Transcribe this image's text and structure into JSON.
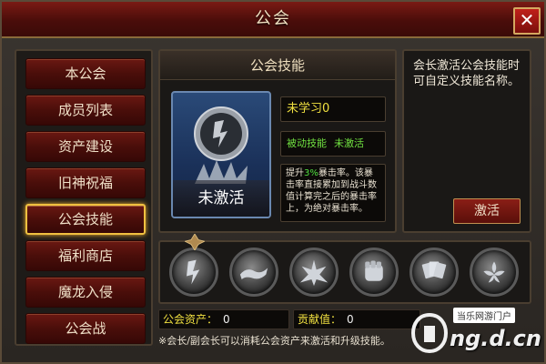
{
  "window": {
    "title": "公会",
    "close_icon": "close-icon",
    "close_glyph": "✕"
  },
  "sidebar": {
    "items": [
      {
        "label": "本公会",
        "active": false
      },
      {
        "label": "成员列表",
        "active": false
      },
      {
        "label": "资产建设",
        "active": false
      },
      {
        "label": "旧神祝福",
        "active": false
      },
      {
        "label": "公会技能",
        "active": true
      },
      {
        "label": "福利商店",
        "active": false
      },
      {
        "label": "魔龙入侵",
        "active": false
      },
      {
        "label": "公会战",
        "active": false
      }
    ]
  },
  "skill_panel": {
    "title": "公会技能",
    "card_status": "未激活",
    "level_text": "未学习0",
    "type_label": "被动技能",
    "type_status": "未激活",
    "desc_prefix": "提升",
    "desc_highlight": "3%",
    "desc_suffix": "暴击率。该暴击率直接累加到战斗数值计算完之后的暴击率上，为绝对暴击率。"
  },
  "right_panel": {
    "description": "会长激活公会技能时可自定义技能名称。",
    "activate_label": "激活"
  },
  "skill_slots": [
    {
      "icon": "claw-skill-icon",
      "selected": true
    },
    {
      "icon": "hands-skill-icon",
      "selected": false
    },
    {
      "icon": "wings-skill-icon",
      "selected": false
    },
    {
      "icon": "fist-skill-icon",
      "selected": false
    },
    {
      "icon": "cards-skill-icon",
      "selected": false
    },
    {
      "icon": "flower-skill-icon",
      "selected": false
    }
  ],
  "stats": {
    "assets_label": "公会资产：",
    "assets_value": "0",
    "contribution_label": "贡献值：",
    "contribution_value": "0"
  },
  "note": "※会长/副会长可以消耗公会资产来激活和升级技能。",
  "watermark": {
    "top": "当乐网游门户",
    "main": "ng.d.cn"
  },
  "colors": {
    "accent_gold": "#f0c040",
    "button_red": "#6a1812",
    "highlight_green": "#50e040",
    "level_yellow": "#f0e040"
  }
}
